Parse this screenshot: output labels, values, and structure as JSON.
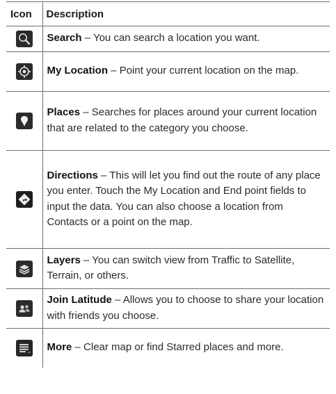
{
  "table": {
    "headers": {
      "icon": "Icon",
      "description": "Description"
    },
    "rows": [
      {
        "icon": "search-icon",
        "term": "Search",
        "dash": " – ",
        "text": "You can search a location you want."
      },
      {
        "icon": "my-location-icon",
        "term": "My Location",
        "dash": " – ",
        "text": "Point your current location on the map."
      },
      {
        "icon": "places-pin-icon",
        "term": "Places",
        "dash": " – ",
        "text": "Searches for places around your current location that are related to the category you choose."
      },
      {
        "icon": "directions-icon",
        "term": "Directions",
        "dash": " – ",
        "text": "This will let you find out the route of any place you enter. Touch the My Location and End point fields to input the data. You can also choose a location from Contacts or a point on the map."
      },
      {
        "icon": "layers-icon",
        "term": "Layers",
        "dash": " – ",
        "text": "You can switch view from Traffic to Satellite, Terrain, or others."
      },
      {
        "icon": "join-latitude-icon",
        "term": "Join Latitude",
        "dash": " – ",
        "text": "Allows you to choose to share your location with friends you choose."
      },
      {
        "icon": "more-menu-icon",
        "term": "More",
        "dash": " – ",
        "text": "Clear map or find Starred places and more."
      }
    ]
  }
}
